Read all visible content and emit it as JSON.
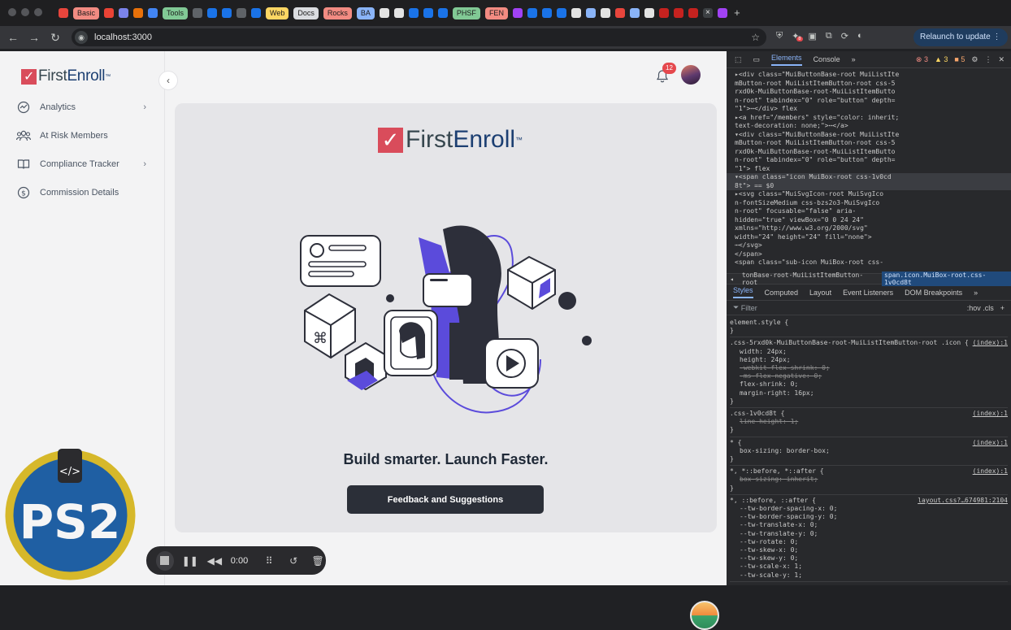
{
  "browser": {
    "tab_chips": [
      {
        "label": "Basic",
        "color": "#f28b82"
      },
      {
        "label": "Tools",
        "color": "#81c995"
      },
      {
        "label": "Web",
        "color": "#fdd663"
      },
      {
        "label": "Docs",
        "color": "#dadce0"
      },
      {
        "label": "Rocks",
        "color": "#f28b82"
      },
      {
        "label": "BA",
        "color": "#8ab4f8"
      },
      {
        "label": "PHSF",
        "color": "#81c995"
      },
      {
        "label": "FEN",
        "color": "#f28b82"
      }
    ],
    "url": "localhost:3000",
    "relaunch_label": "Relaunch to update",
    "extension_badge": "8"
  },
  "sidebar": {
    "logo_first": "First",
    "logo_enroll": "Enroll",
    "logo_tm": "™",
    "items": [
      {
        "label": "Analytics",
        "icon": "analytics-icon",
        "has_chevron": true
      },
      {
        "label": "At Risk Members",
        "icon": "users-icon",
        "has_chevron": false
      },
      {
        "label": "Compliance Tracker",
        "icon": "book-icon",
        "has_chevron": true
      },
      {
        "label": "Commission Details",
        "icon": "dollar-icon",
        "has_chevron": false
      }
    ]
  },
  "header": {
    "notification_count": "12"
  },
  "main": {
    "logo_first": "First",
    "logo_enroll": "Enroll",
    "logo_tm": "™",
    "tagline": "Build smarter. Launch Faster.",
    "feedback_label": "Feedback and Suggestions"
  },
  "overlay": {
    "ps2_label": "PS2",
    "recorder_time": "0:00"
  },
  "devtools": {
    "tabs": [
      "Elements",
      "Console"
    ],
    "error_count": "3",
    "warning_count": "3",
    "issue_count": "5",
    "elements_lines": [
      "▸<div class=\"MuiButtonBase-root MuiListIte",
      "mButton-root MuiListItemButton-root css-5",
      "rxd0k-MuiButtonBase-root-MuiListItemButto",
      "n-root\" tabindex=\"0\" role=\"button\" depth=",
      "\"1\">⋯</div> flex",
      "▸<a href=\"/members\" style=\"color: inherit;",
      "text-decoration: none;\">⋯</a>",
      "▾<div class=\"MuiButtonBase-root MuiListIte",
      "mButton-root MuiListItemButton-root css-5",
      "rxd0k-MuiButtonBase-root-MuiListItemButto",
      "n-root\" tabindex=\"0\" role=\"button\" depth=",
      "\"1\"> flex",
      "▾<span class=\"icon MuiBox-root css-1v0cd",
      "8t\"> == $0",
      "▸<svg class=\"MuiSvgIcon-root MuiSvgIco",
      "n-fontSizeMedium css-bzs2o3-MuiSvgIco",
      "n-root\" focusable=\"false\" aria-",
      "hidden=\"true\" viewBox=\"0 0 24 24\"",
      "xmlns=\"http://www.w3.org/2000/svg\"",
      "width=\"24\" height=\"24\" fill=\"none\">",
      "⋯</svg>",
      "</span>",
      "<span class=\"sub-icon MuiBox-root css-"
    ],
    "breadcrumb_prev": "tonBase-root-MuiListItemButton-root",
    "breadcrumb_current": "span.icon.MuiBox-root.css-1v0cd8t",
    "sub_tabs": [
      "Styles",
      "Computed",
      "Layout",
      "Event Listeners",
      "DOM Breakpoints"
    ],
    "filter_placeholder": "Filter",
    "filter_hov": ":hov .cls",
    "rules": [
      {
        "selector": "element.style {",
        "source": "",
        "props": []
      },
      {
        "selector": ".css-5rxd0k-MuiButtonBase-root-MuiListItemButton-root .icon {",
        "source": "(index):1",
        "props": [
          {
            "text": "width: 24px;",
            "struck": false
          },
          {
            "text": "height: 24px;",
            "struck": false
          },
          {
            "text": "-webkit-flex-shrink: 0;",
            "struck": true
          },
          {
            "text": "-ms-flex-negative: 0;",
            "struck": true
          },
          {
            "text": "flex-shrink: 0;",
            "struck": false
          },
          {
            "text": "margin-right: 16px;",
            "struck": false
          }
        ]
      },
      {
        "selector": ".css-1v0cd8t {",
        "source": "(index):1",
        "props": [
          {
            "text": "line-height: 1;",
            "struck": true
          }
        ]
      },
      {
        "selector": "* {",
        "source": "(index):1",
        "props": [
          {
            "text": "box-sizing: border-box;",
            "struck": false
          }
        ]
      },
      {
        "selector": "*, *::before, *::after {",
        "source": "(index):1",
        "props": [
          {
            "text": "box-sizing: inherit;",
            "struck": true
          }
        ]
      },
      {
        "selector": "*, ::before, ::after {",
        "source": "layout.css?…674981:2104",
        "props": [
          {
            "text": "--tw-border-spacing-x: 0;",
            "struck": false
          },
          {
            "text": "--tw-border-spacing-y: 0;",
            "struck": false
          },
          {
            "text": "--tw-translate-x: 0;",
            "struck": false
          },
          {
            "text": "--tw-translate-y: 0;",
            "struck": false
          },
          {
            "text": "--tw-rotate: 0;",
            "struck": false
          },
          {
            "text": "--tw-skew-x: 0;",
            "struck": false
          },
          {
            "text": "--tw-skew-y: 0;",
            "struck": false
          },
          {
            "text": "--tw-scale-x: 1;",
            "struck": false
          },
          {
            "text": "--tw-scale-y: 1;",
            "struck": false
          }
        ]
      }
    ]
  }
}
